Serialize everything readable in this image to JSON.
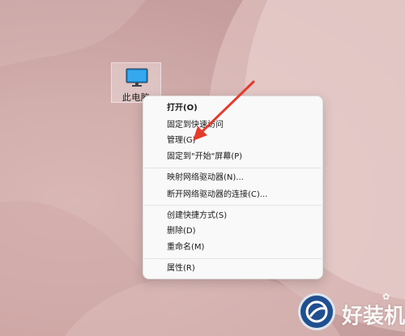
{
  "desktop": {
    "icon": {
      "label": "此电脑",
      "icon": "monitor-icon"
    }
  },
  "context_menu": {
    "groups": [
      {
        "items": [
          {
            "label": "打开(O)",
            "bold": true
          },
          {
            "label": "固定到快速访问"
          },
          {
            "label": "管理(G)"
          },
          {
            "label": "固定到\"开始\"屏幕(P)"
          }
        ]
      },
      {
        "items": [
          {
            "label": "映射网络驱动器(N)..."
          },
          {
            "label": "断开网络驱动器的连接(C)..."
          }
        ]
      },
      {
        "items": [
          {
            "label": "创建快捷方式(S)"
          },
          {
            "label": "删除(D)"
          },
          {
            "label": "重命名(M)"
          }
        ]
      },
      {
        "items": [
          {
            "label": "属性(R)"
          }
        ]
      }
    ]
  },
  "annotation": {
    "arrow_color": "#e53b2c"
  },
  "watermark": {
    "text": "好装机",
    "logo": "blue-circle-logo"
  }
}
